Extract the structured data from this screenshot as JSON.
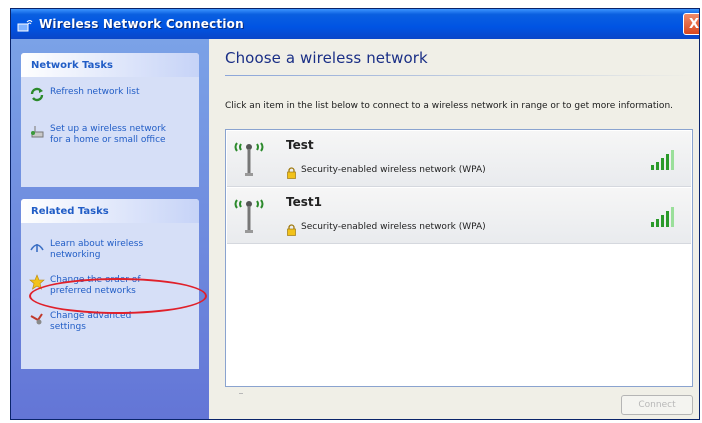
{
  "window": {
    "title": "Wireless Network Connection",
    "close_label": "X"
  },
  "sidebar": {
    "network_tasks": {
      "header": "Network Tasks",
      "items": [
        {
          "label": "Refresh network list",
          "icon": "refresh-icon"
        },
        {
          "label": "Set up a wireless network\nfor a home or small office",
          "icon": "setup-network-icon"
        }
      ]
    },
    "related_tasks": {
      "header": "Related Tasks",
      "items": [
        {
          "label": "Learn about wireless\nnetworking",
          "icon": "help-icon"
        },
        {
          "label": "Change the order of\npreferred networks",
          "icon": "star-icon"
        },
        {
          "label": "Change advanced\nsettings",
          "icon": "settings-icon"
        }
      ]
    }
  },
  "main": {
    "heading": "Choose a wireless network",
    "instructions": "Click an item in the list below to connect to a wireless network in range or to get more information.",
    "networks": [
      {
        "name": "Test",
        "security": "Security-enabled wireless network (WPA)",
        "signal_bars": 5
      },
      {
        "name": "Test1",
        "security": "Security-enabled wireless network (WPA)",
        "signal_bars": 5
      }
    ],
    "connect_label": "Connect"
  },
  "colors": {
    "titlebar": "#0054e3",
    "sidebar": "#7ba2e7",
    "task_link": "#215dc6",
    "highlight": "#e0202a"
  }
}
